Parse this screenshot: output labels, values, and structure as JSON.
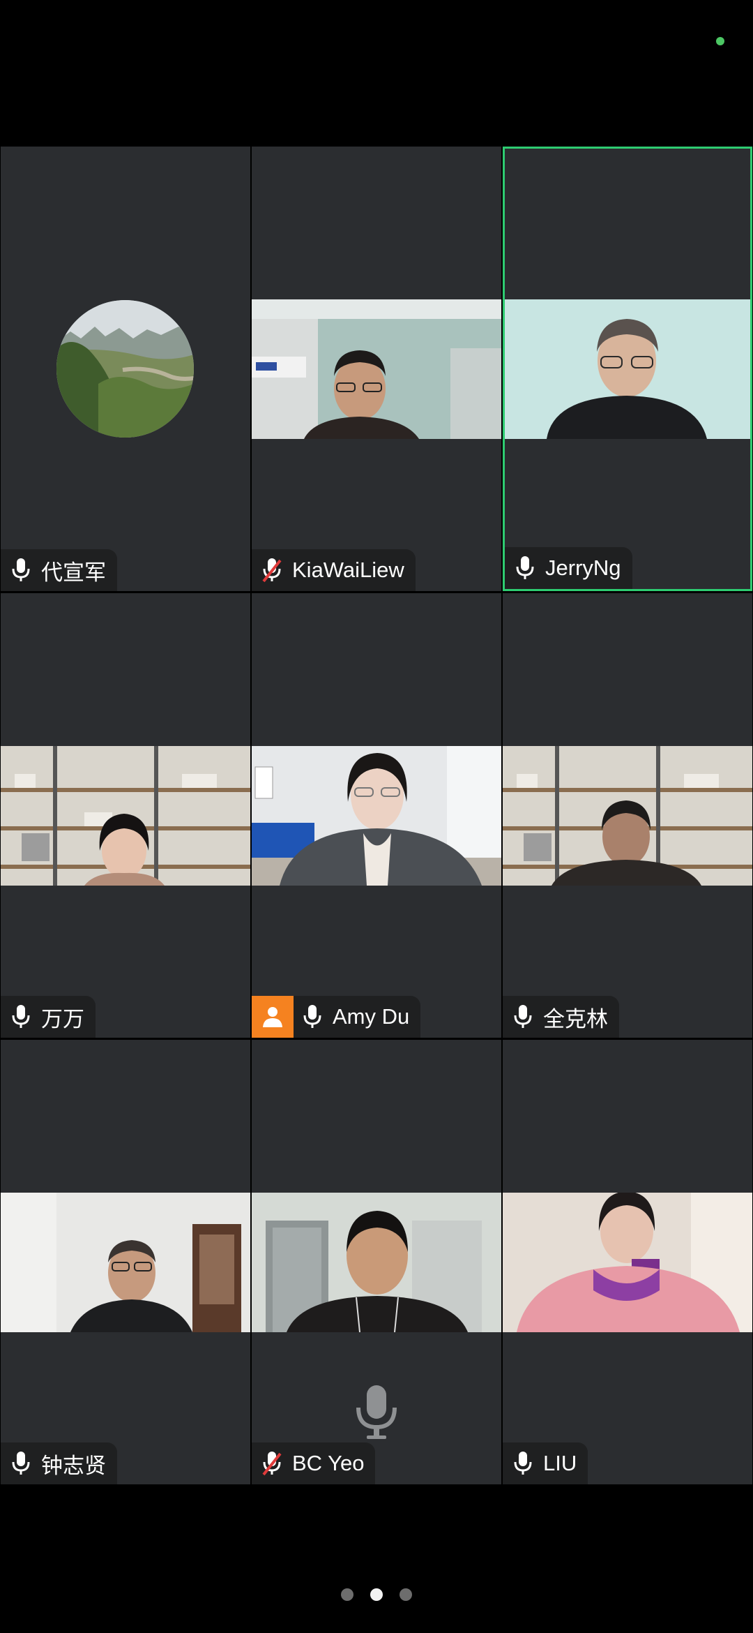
{
  "colors": {
    "status_dot": "#4cc764",
    "active_border": "#2ecc71",
    "host_badge": "#f58220"
  },
  "participants": [
    {
      "name": "代宣军",
      "mic": "on",
      "video": "avatar-landscape"
    },
    {
      "name": "KiaWaiLiew",
      "mic": "muted",
      "video": "camera"
    },
    {
      "name": "JerryNg",
      "mic": "on",
      "video": "camera",
      "active_speaker": true
    },
    {
      "name": "万万",
      "mic": "on",
      "video": "camera"
    },
    {
      "name": "Amy Du",
      "mic": "on",
      "video": "camera",
      "host": true
    },
    {
      "name": "全克林",
      "mic": "on",
      "video": "camera"
    },
    {
      "name": "钟志贤",
      "mic": "on",
      "video": "camera"
    },
    {
      "name": "BC Yeo",
      "mic": "muted",
      "video": "camera",
      "speaking_indicator": true
    },
    {
      "name": "LIU",
      "mic": "on",
      "video": "camera"
    }
  ],
  "pagination": {
    "pages": 3,
    "current": 2
  }
}
